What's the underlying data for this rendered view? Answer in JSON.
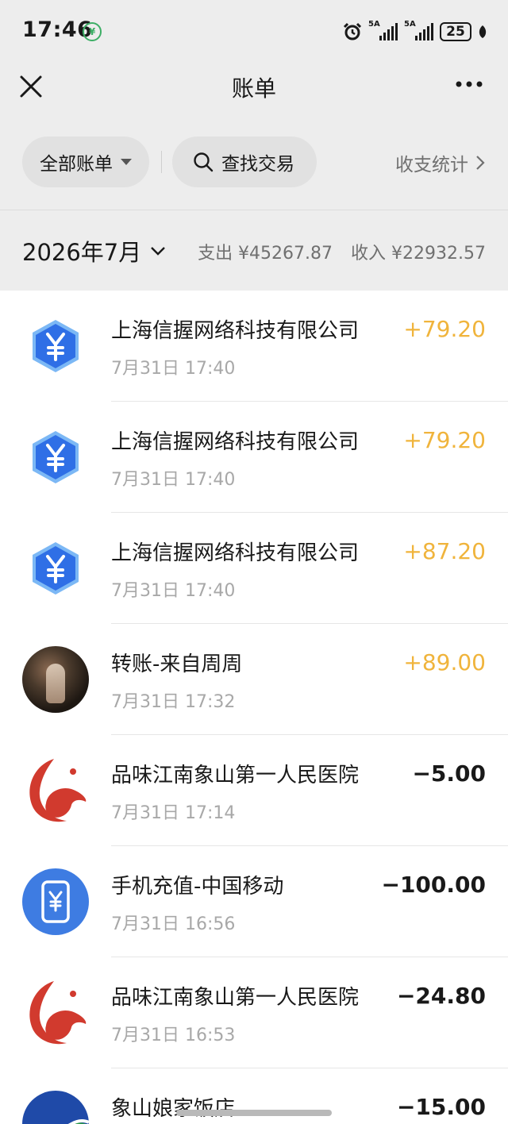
{
  "status_bar": {
    "time": "17:46",
    "network_1": "5A",
    "network_2": "5A",
    "battery": "25"
  },
  "nav": {
    "title": "账单"
  },
  "filters": {
    "all_bills": "全部账单",
    "search": "查找交易",
    "stats": "收支统计"
  },
  "month": {
    "label": "2026年7月",
    "expense": "支出 ¥45267.87",
    "income": "收入 ¥22932.57"
  },
  "transactions": [
    {
      "title": "上海信握网络科技有限公司",
      "time": "7月31日 17:40",
      "amount": "+79.20",
      "type": "income",
      "icon": "payment-yuan-icon"
    },
    {
      "title": "上海信握网络科技有限公司",
      "time": "7月31日 17:40",
      "amount": "+79.20",
      "type": "income",
      "icon": "payment-yuan-icon"
    },
    {
      "title": "上海信握网络科技有限公司",
      "time": "7月31日 17:40",
      "amount": "+87.20",
      "type": "income",
      "icon": "payment-yuan-icon"
    },
    {
      "title": "转账-来自周周",
      "time": "7月31日 17:32",
      "amount": "+89.00",
      "type": "income",
      "icon": "user-avatar"
    },
    {
      "title": "品味江南象山第一人民医院",
      "time": "7月31日 17:14",
      "amount": "−5.00",
      "type": "expense",
      "icon": "merchant-logo-icon"
    },
    {
      "title": "手机充值-中国移动",
      "time": "7月31日 16:56",
      "amount": "−100.00",
      "type": "expense",
      "icon": "mobile-recharge-icon"
    },
    {
      "title": "品味江南象山第一人民医院",
      "time": "7月31日 16:53",
      "amount": "−24.80",
      "type": "expense",
      "icon": "merchant-logo-icon"
    },
    {
      "title": "象山娘家饭店",
      "time": "",
      "amount": "−15.00",
      "type": "expense",
      "icon": "restaurant-logo-icon"
    }
  ],
  "colors": {
    "income": "#f0b43c",
    "expense": "#191919",
    "brand_blue": "#3e7ce2",
    "merchant_red": "#d13a2e"
  }
}
